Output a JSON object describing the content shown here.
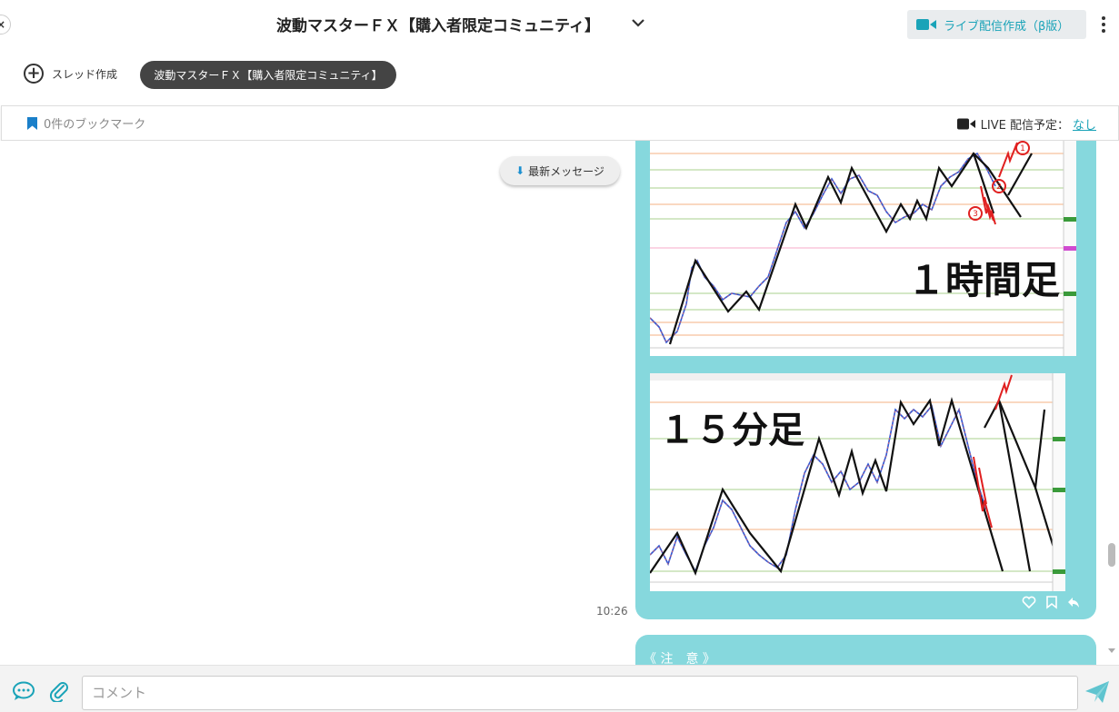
{
  "header": {
    "community_title": "波動マスターＦＸ【購入者限定コミュニティ】",
    "live_button_label": "ライブ配信作成（β版）",
    "thread_create_label": "スレッド作成",
    "thread_chip_label": "波動マスターＦＸ【購入者限定コミュニティ】"
  },
  "bookmark_bar": {
    "bookmark_count_label": "0件のブックマーク",
    "live_schedule_label": "LIVE 配信予定：",
    "live_schedule_value": "なし"
  },
  "chat": {
    "latest_messages_label": "最新メッセージ",
    "message": {
      "time": "10:26",
      "images": [
        {
          "label": "１時間足",
          "markers": [
            "①",
            "②",
            "③"
          ]
        },
        {
          "label": "１５分足"
        }
      ]
    },
    "next_message_preview": "《 注　意 》"
  },
  "composer": {
    "placeholder": "コメント"
  },
  "colors": {
    "accent": "#1aa3b8",
    "bubble": "#86d8dd",
    "chip_bg": "#444444"
  },
  "icons": [
    "back-icon",
    "chevron-down-icon",
    "video-camera-icon",
    "kebab-menu-icon",
    "plus-circle-icon",
    "bookmark-icon",
    "arrow-down-icon",
    "heart-icon",
    "bookmark-outline-icon",
    "reply-icon",
    "chat-bubble-icon",
    "paperclip-icon",
    "send-icon"
  ]
}
